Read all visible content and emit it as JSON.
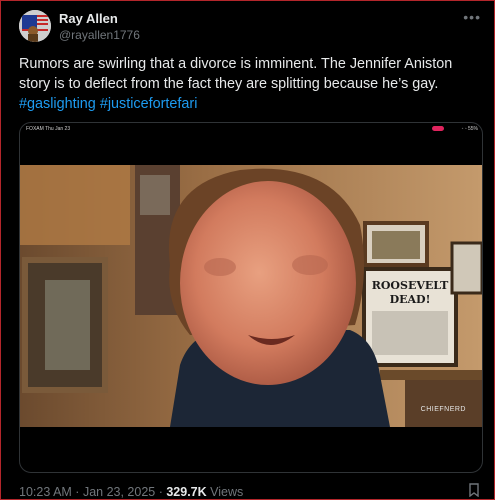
{
  "tweet": {
    "author_name": "Ray Allen",
    "author_handle": "@rayallen1776",
    "text_main": "Rumors are swirling that a divorce is imminent. The Jennifer Aniston story is to deflect from the fact they are splitting because he’s gay.",
    "hashtags": [
      "#gaslighting",
      "#justicefortefari"
    ],
    "time": "10:23 AM",
    "date": "Jan 23, 2025",
    "views_count": "329.7K",
    "views_label": "Views"
  },
  "video": {
    "status_left": "FOXAM  Thu Jan 23",
    "status_right": "◦ ◦ 55%",
    "sign_line1": "ROOSEVELT",
    "sign_line2": "DEAD!",
    "watermark": "CHIEFNERD"
  },
  "colors": {
    "accent": "#1d9bf0",
    "record": "#e0245e",
    "border": "#b3262b"
  }
}
